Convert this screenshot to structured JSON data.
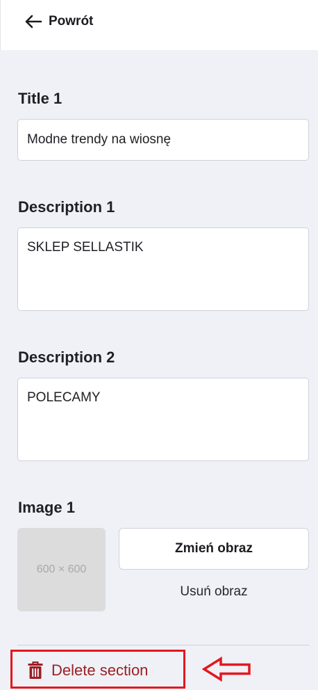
{
  "header": {
    "back_label": "Powrót"
  },
  "fields": {
    "title1": {
      "label": "Title 1",
      "value": "Modne trendy na wiosnę"
    },
    "description1": {
      "label": "Description 1",
      "value": "SKLEP SELLASTIK"
    },
    "description2": {
      "label": "Description 2",
      "value": "POLECAMY"
    }
  },
  "image1": {
    "label": "Image 1",
    "placeholder_text": "600 × 600",
    "change_label": "Zmień obraz",
    "remove_label": "Usuń obraz"
  },
  "footer": {
    "delete_label": "Delete section",
    "delete_icon": "trash-icon",
    "annotation_icon": "arrow-left-outline-icon"
  },
  "colors": {
    "background": "#f0f1f6",
    "delete_text": "#9a1f24",
    "highlight_red": "#e3171e"
  }
}
